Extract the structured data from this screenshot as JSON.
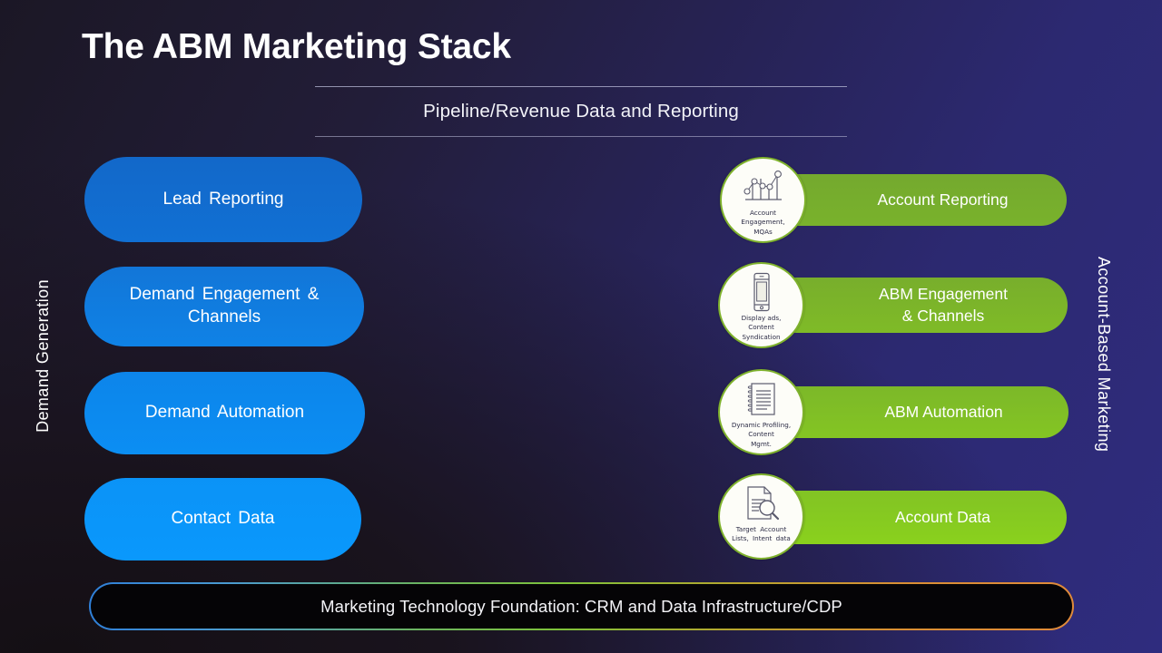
{
  "slide": {
    "title": "The ABM Marketing Stack",
    "header_band": "Pipeline/Revenue Data and Reporting",
    "side_label_left": "Demand Generation",
    "side_label_right": "Account-Based Marketing",
    "footer": "Marketing Technology Foundation: CRM and Data Infrastructure/CDP"
  },
  "colors": {
    "blue_top": "#1268c9",
    "blue_bottom": "#0a98fc",
    "green_top": "#74a92e",
    "green_bottom": "#8ad11d",
    "badge_ring": "#7fb22d",
    "background_dark": "#1b1725",
    "background_indigo": "#2f2c7e",
    "text_white": "#ffffff",
    "footer_fill": "#050406"
  },
  "left_column": {
    "items": [
      {
        "label": "Lead Reporting"
      },
      {
        "label": "Demand Engagement  &\nChannels"
      },
      {
        "label": "Demand Automation"
      },
      {
        "label": "Contact Data"
      }
    ]
  },
  "right_column": {
    "items": [
      {
        "label": "Account Reporting"
      },
      {
        "label": "ABM Engagement\n& Channels"
      },
      {
        "label": "ABM Automation"
      },
      {
        "label": "Account Data"
      }
    ]
  },
  "badges": [
    {
      "icon": "bar-line-chart-icon",
      "caption": "Account\nEngagement,\nMQAs"
    },
    {
      "icon": "smartphone-icon",
      "caption": "Display ads,\nContent\nSyndication"
    },
    {
      "icon": "spiral-notepad-icon",
      "caption": "Dynamic Profiling,\nContent\nMgmt."
    },
    {
      "icon": "document-search-icon",
      "caption": "Target  Account\nLists, Intent data"
    }
  ]
}
